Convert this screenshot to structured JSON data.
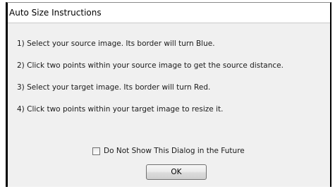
{
  "window": {
    "title": "Auto Size Instructions"
  },
  "instructions": [
    "1) Select your source image. Its border will turn Blue.",
    "2) Click two points within your source image to get the source distance.",
    "3) Select your target image. Its border will turn Red.",
    "4) Click two points within your target image to resize it."
  ],
  "checkbox": {
    "label": "Do Not Show This Dialog in the Future",
    "checked": false
  },
  "buttons": {
    "ok_label": "OK"
  }
}
